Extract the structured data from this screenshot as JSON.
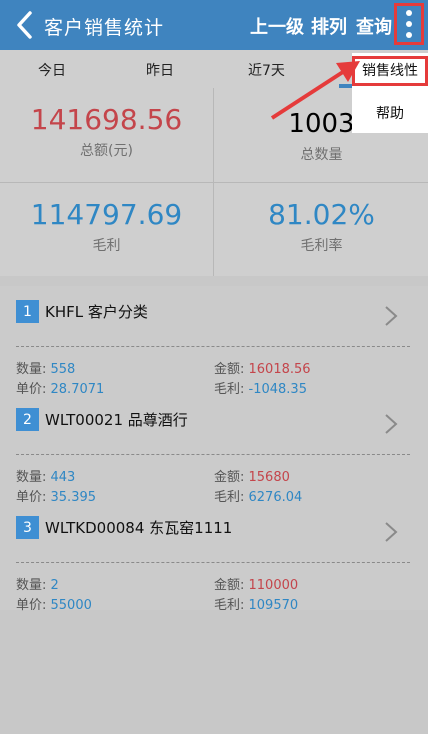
{
  "header": {
    "title": "客户销售统计",
    "actions": [
      "上一级",
      "排列",
      "查询"
    ],
    "more_icon": "vertical-dots-icon",
    "accent": "#3f84bf"
  },
  "tabs": [
    "今日",
    "昨日",
    "近7天"
  ],
  "summary": {
    "total_amount": {
      "value": "141698.56",
      "label": "总额(元)"
    },
    "total_qty": {
      "value": "1003",
      "label": "总数量"
    },
    "gross_profit": {
      "value": "114797.69",
      "label": "毛利"
    },
    "gross_margin": {
      "value": "81.02%",
      "label": "毛利率"
    }
  },
  "items": [
    {
      "index": "1",
      "title": "KHFL 客户分类",
      "qty_label": "数量: ",
      "qty": "558",
      "amt_label": "金额: ",
      "amount": "16018.56",
      "price_label": "单价: ",
      "price": "28.7071",
      "profit_label": "毛利: ",
      "profit": "-1048.35"
    },
    {
      "index": "2",
      "title": "WLT00021 品尊酒行",
      "qty_label": "数量: ",
      "qty": "443",
      "amt_label": "金额: ",
      "amount": "15680",
      "price_label": "单价: ",
      "price": "35.395",
      "profit_label": "毛利: ",
      "profit": "6276.04"
    },
    {
      "index": "3",
      "title": "WLTKD00084 东瓦窑1111",
      "qty_label": "数量: ",
      "qty": "2",
      "amt_label": "金额: ",
      "amount": "110000",
      "price_label": "单价: ",
      "price": "55000",
      "profit_label": "毛利: ",
      "profit": "109570"
    }
  ],
  "menu": {
    "items": [
      "销售线性",
      "帮助"
    ]
  },
  "colors": {
    "red": "#c4454b",
    "blue": "#2f87c4",
    "highlight": "#e53b3b"
  }
}
